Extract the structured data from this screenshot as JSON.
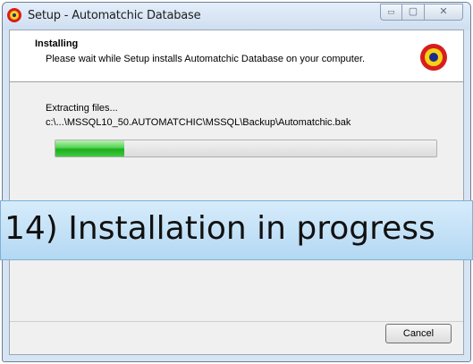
{
  "window": {
    "title": "Setup - Automatchic Database",
    "controls": {
      "minimize": "▭",
      "maximize": "▢",
      "close": "✕"
    }
  },
  "header": {
    "heading": "Installing",
    "subheading": "Please wait while Setup installs Automatchic Database on your computer.",
    "logo_icon": "target-logo-icon"
  },
  "body": {
    "status": "Extracting files...",
    "current_file": "c:\\...\\MSSQL10_50.AUTOMATCHIC\\MSSQL\\Backup\\Automatchic.bak",
    "progress_fraction": 0.18
  },
  "banner": {
    "text": "14) Installation in progress"
  },
  "footer": {
    "cancel_label": "Cancel"
  },
  "colors": {
    "progress_green": "#1fae1f",
    "logo_red": "#d71e1e",
    "logo_yellow": "#f7d116",
    "logo_blue": "#1b2d8a",
    "banner_blue": "#b4d8f3"
  }
}
